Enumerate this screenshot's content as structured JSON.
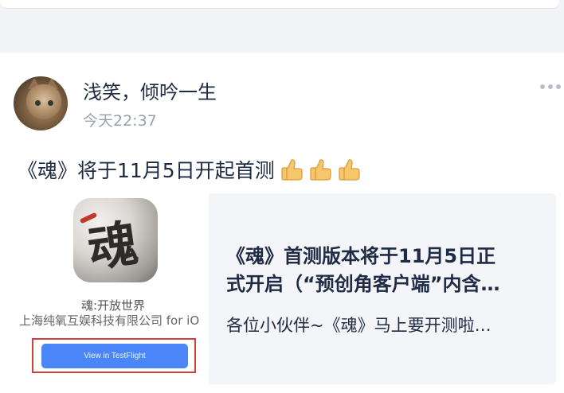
{
  "post": {
    "user_name": "浅笑，倾吟一生",
    "time": "今天22:37",
    "text": "《魂》将于11月5日开起首测",
    "emoji_count": 3,
    "more_icon": "more-dots-icon"
  },
  "link_card": {
    "app_icon_glyph": "魂",
    "app_name": "魂:开放世界",
    "app_developer": "上海纯氧互娱科技有限公司 for iO",
    "testflight_button": "View in TestFlight",
    "title_line1": "《魂》首测版本将于11月5日正",
    "title_line2": "式开启（“预创角客户端”内含…",
    "description": "各位小伙伴~《魂》马上要开测啦…"
  },
  "colors": {
    "page_bg": "#f3f4f8",
    "text_primary": "#1f2a44",
    "text_secondary": "#9aa0ad",
    "testflight_blue": "#4a86f7",
    "highlight_red": "#d0413b"
  }
}
